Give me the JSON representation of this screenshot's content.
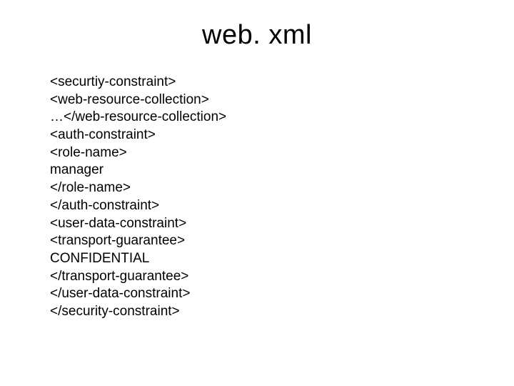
{
  "slide": {
    "title": "web. xml",
    "lines": [
      "<securtiy-constraint>",
      "<web-resource-collection>",
      "…</web-resource-collection>",
      "<auth-constraint>",
      "<role-name>",
      "manager",
      "</role-name>",
      "</auth-constraint>",
      "<user-data-constraint>",
      "<transport-guarantee>",
      "CONFIDENTIAL",
      "</transport-guarantee>",
      "</user-data-constraint>",
      "</security-constraint>"
    ]
  }
}
